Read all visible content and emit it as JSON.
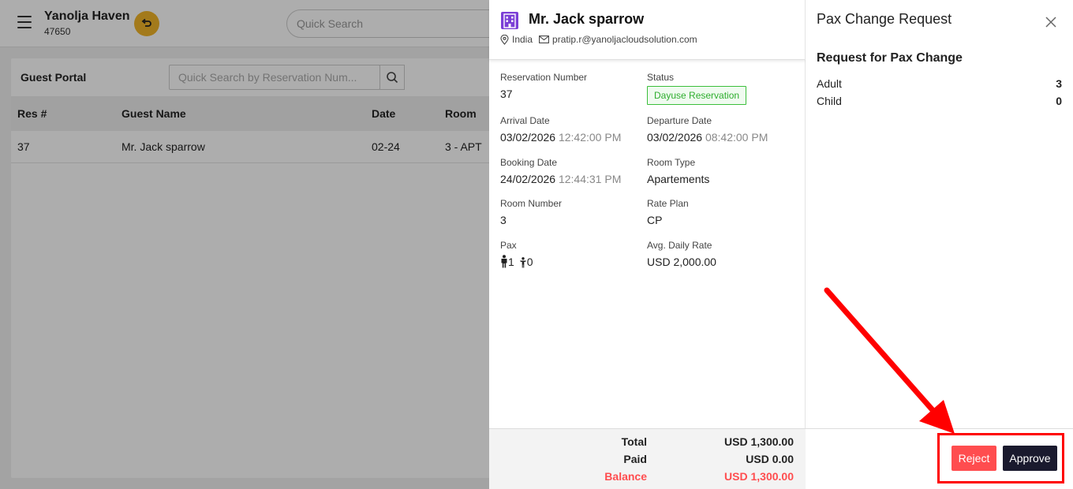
{
  "app": {
    "hotel_name": "Yanolja Haven",
    "hotel_id": "47650",
    "quick_search_placeholder": "Quick Search"
  },
  "portal": {
    "title": "Guest Portal",
    "search_placeholder": "Quick Search by Reservation Num...",
    "columns": [
      "Res #",
      "Guest Name",
      "Date",
      "Room"
    ],
    "rows": [
      {
        "res": "37",
        "guest": "Mr. Jack sparrow",
        "date": "02-24",
        "room": "3 - APT"
      }
    ]
  },
  "reservation": {
    "guest_name": "Mr. Jack sparrow",
    "country": "India",
    "email": "pratip.r@yanoljacloudsolution.com",
    "fields": {
      "reservation_number": {
        "label": "Reservation Number",
        "value": "37"
      },
      "status": {
        "label": "Status",
        "value": "Dayuse Reservation"
      },
      "arrival_date": {
        "label": "Arrival Date",
        "date": "03/02/2026",
        "time": "12:42:00 PM"
      },
      "departure_date": {
        "label": "Departure Date",
        "date": "03/02/2026",
        "time": "08:42:00 PM"
      },
      "booking_date": {
        "label": "Booking Date",
        "date": "24/02/2026",
        "time": "12:44:31 PM"
      },
      "room_type": {
        "label": "Room Type",
        "value": "Apartements"
      },
      "room_number": {
        "label": "Room Number",
        "value": "3"
      },
      "rate_plan": {
        "label": "Rate Plan",
        "value": "CP"
      },
      "pax": {
        "label": "Pax",
        "adult": "1",
        "child": "0"
      },
      "avg_daily_rate": {
        "label": "Avg. Daily Rate",
        "value": "USD 2,000.00"
      }
    },
    "totals": {
      "total_label": "Total",
      "total_value": "USD 1,300.00",
      "paid_label": "Paid",
      "paid_value": "USD 0.00",
      "balance_label": "Balance",
      "balance_value": "USD 1,300.00"
    }
  },
  "pax_change": {
    "title": "Pax Change Request",
    "subtitle": "Request for Pax Change",
    "adult_label": "Adult",
    "adult_value": "3",
    "child_label": "Child",
    "child_value": "0",
    "reject_label": "Reject",
    "approve_label": "Approve"
  },
  "colors": {
    "accent_purple": "#7b3fd6",
    "reject_red": "#ff4d4f",
    "approve_dark": "#1a1a2e",
    "status_green": "#2fae2f",
    "annotation_red": "#ff0000"
  }
}
